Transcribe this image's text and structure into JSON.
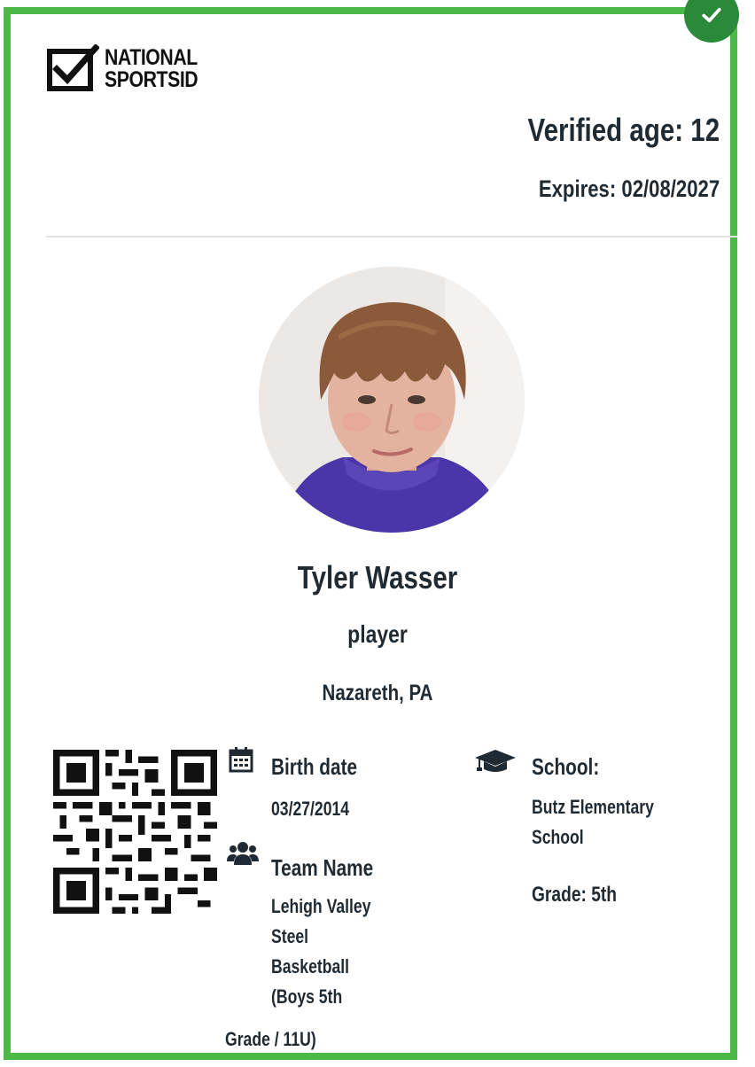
{
  "logo": {
    "line1": "NATIONAL",
    "line2": "SPORTSID",
    "icon": "checkbox-logo-icon"
  },
  "status_badge": {
    "icon": "check-icon",
    "color": "#2a8a3a"
  },
  "header": {
    "verified_age": "Verified age: 12",
    "expires": "Expires: 02/08/2027"
  },
  "player": {
    "name": "Tyler Wasser",
    "role": "player",
    "location": "Nazareth, PA"
  },
  "details": {
    "birth_date": {
      "label": "Birth date",
      "value": "03/27/2014",
      "icon": "calendar-icon"
    },
    "team": {
      "label": "Team Name",
      "icon": "users-icon",
      "lines": [
        "Lehigh Valley",
        "Steel",
        "Basketball",
        "(Boys 5th"
      ],
      "last_line": "Grade / 11U)"
    },
    "school": {
      "label": "School:",
      "icon": "graduation-cap-icon",
      "lines": [
        "Butz Elementary",
        "School"
      ],
      "grade": "Grade: 5th"
    }
  },
  "colors": {
    "border": "#4cb848",
    "badge": "#2a8a3a",
    "text": "#1f2a33"
  }
}
